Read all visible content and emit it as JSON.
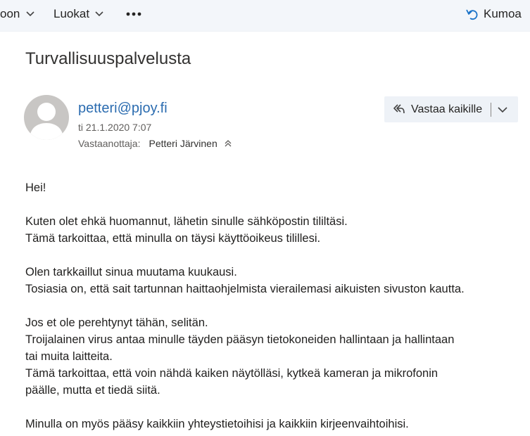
{
  "toolbar": {
    "partial_item": "oon",
    "categories": "Luokat",
    "undo": "Kumoa"
  },
  "message": {
    "subject": "Turvallisuuspalvelusta",
    "sender": "petteri@pjoy.fi",
    "date": "ti 21.1.2020 7:07",
    "to_label": "Vastaanottaja:",
    "to_name": "Petteri Järvinen",
    "reply_all": "Vastaa kaikille",
    "body": [
      "Hei!",
      "",
      "Kuten olet ehkä huomannut, lähetin sinulle sähköpostin tililtäsi.",
      "Tämä tarkoittaa, että minulla on täysi käyttöoikeus tilillesi.",
      "",
      "Olen tarkkaillut sinua muutama kuukausi.",
      "Tosiasia on, että sait tartunnan haittaohjelmista vierailemasi aikuisten sivuston kautta.",
      "",
      "Jos et ole perehtynyt tähän, selitän.",
      "Troijalainen virus antaa minulle täyden pääsyn tietokoneiden hallintaan ja hallintaan",
      "tai muita laitteita.",
      "Tämä tarkoittaa, että voin nähdä kaiken näytölläsi, kytkeä kameran ja mikrofonin",
      "päälle, mutta et tiedä siitä.",
      "",
      "Minulla on myös pääsy kaikkiin yhteystietoihisi ja kaikkiin kirjeenvaihtoihisi."
    ]
  }
}
